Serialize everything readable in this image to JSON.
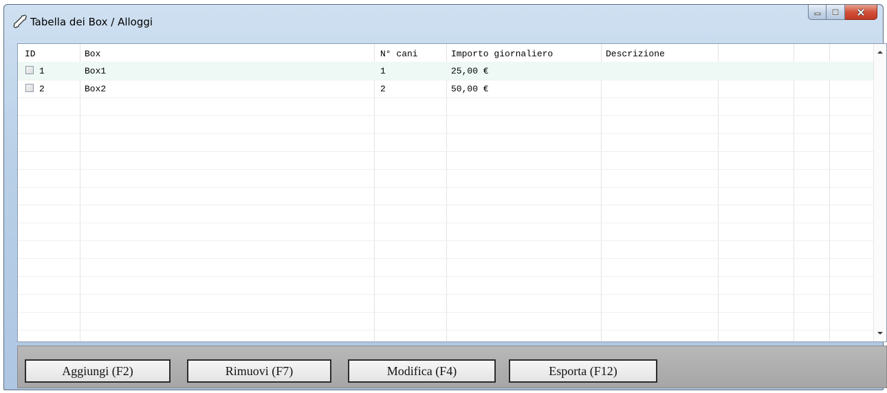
{
  "window": {
    "title": "Tabella dei Box / Alloggi",
    "title_icon": "bone-icon",
    "controls": {
      "minimize": "minimize-icon",
      "maximize": "maximize-icon",
      "close": "close-icon"
    }
  },
  "table": {
    "columns": [
      "ID",
      "Box",
      "N° cani",
      "Importo giornaliero",
      "Descrizione"
    ],
    "rows": [
      {
        "id": "1",
        "box": "Box1",
        "cani": "1",
        "importo": "25,00 €",
        "descrizione": "",
        "checked": false,
        "selected": true
      },
      {
        "id": "2",
        "box": "Box2",
        "cani": "2",
        "importo": "50,00 €",
        "descrizione": "",
        "checked": false,
        "selected": false
      }
    ]
  },
  "toolbar": {
    "add_label": "Aggiungi (F2)",
    "remove_label": "Rimuovi (F7)",
    "edit_label": "Modifica (F4)",
    "export_label": "Esporta (F12)"
  },
  "colors": {
    "selected_row": "#eef9f6",
    "toolbar_bg": "#a6a6a6",
    "close_button": "#c23a22"
  }
}
